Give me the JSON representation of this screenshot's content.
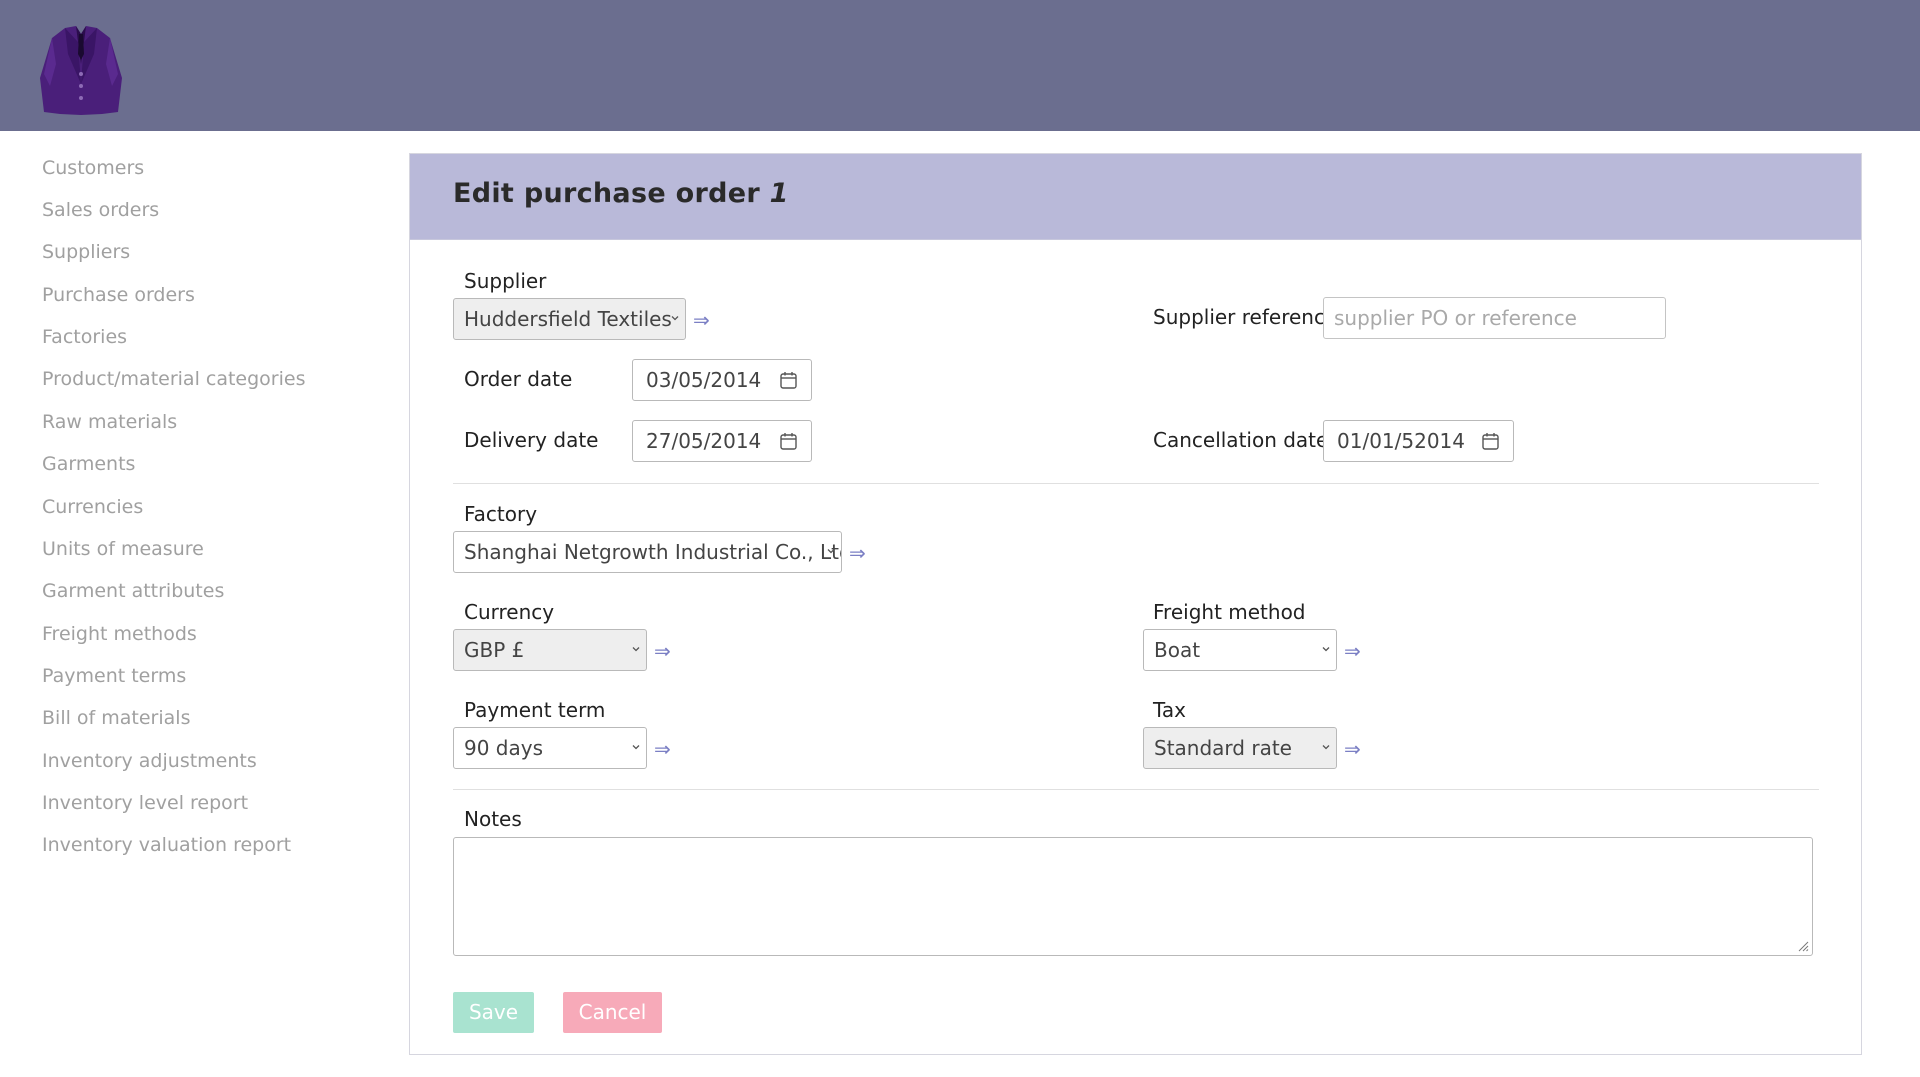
{
  "header": {
    "logo_icon": "jacket-icon"
  },
  "sidebar": {
    "items": [
      {
        "label": "Customers"
      },
      {
        "label": "Sales orders"
      },
      {
        "label": "Suppliers"
      },
      {
        "label": "Purchase orders"
      },
      {
        "label": "Factories"
      },
      {
        "label": "Product/material categories"
      },
      {
        "label": "Raw materials"
      },
      {
        "label": "Garments"
      },
      {
        "label": "Currencies"
      },
      {
        "label": "Units of measure"
      },
      {
        "label": "Garment attributes"
      },
      {
        "label": "Freight methods"
      },
      {
        "label": "Payment terms"
      },
      {
        "label": "Bill of materials"
      },
      {
        "label": "Inventory adjustments"
      },
      {
        "label": "Inventory level report"
      },
      {
        "label": "Inventory valuation report"
      }
    ]
  },
  "form": {
    "title": "Edit purchase order",
    "order_number": "1",
    "supplier": {
      "label": "Supplier",
      "value": "Huddersfield Textiles"
    },
    "supplier_reference": {
      "label": "Supplier reference",
      "value": "",
      "placeholder": "supplier PO or reference"
    },
    "order_date": {
      "label": "Order date",
      "value": "03/05/2014"
    },
    "delivery_date": {
      "label": "Delivery date",
      "value": "27/05/2014"
    },
    "cancellation_date": {
      "label": "Cancellation date",
      "value": "01/01/52014"
    },
    "factory": {
      "label": "Factory",
      "value": "Shanghai Netgrowth Industrial Co., Ltd"
    },
    "currency": {
      "label": "Currency",
      "value": "GBP £"
    },
    "freight_method": {
      "label": "Freight method",
      "value": "Boat"
    },
    "payment_term": {
      "label": "Payment term",
      "value": "90 days"
    },
    "tax": {
      "label": "Tax",
      "value": "Standard rate"
    },
    "notes": {
      "label": "Notes",
      "value": ""
    },
    "link_arrow": "⇒",
    "save_label": "Save",
    "cancel_label": "Cancel"
  },
  "colors": {
    "topbar": "#6b6e8f",
    "panel_header": "#b9b9d9",
    "save_button": "#a9e3d0",
    "cancel_button": "#f7aab9",
    "link_arrow": "#7b7fc4"
  }
}
